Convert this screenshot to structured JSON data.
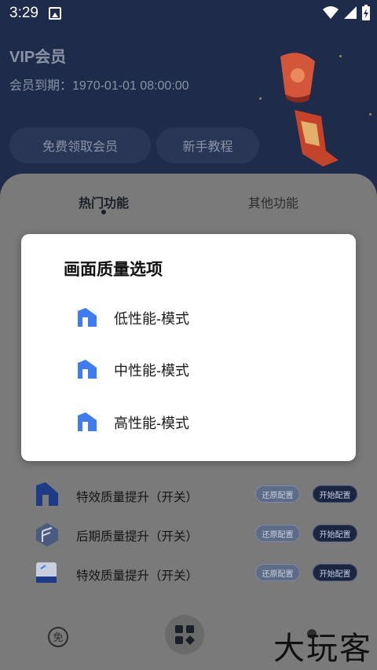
{
  "status_bar": {
    "time": "3:29"
  },
  "header": {
    "vip_title": "VIP会员",
    "vip_expire": "会员到期：1970-01-01 08:00:00",
    "free_vip_button": "免费领取会员",
    "beginner_guide_button": "新手教程"
  },
  "tabs": {
    "hot": "热门功能",
    "other": "其他功能"
  },
  "rows": [
    {
      "label": "特效质量提升（开关）",
      "restore": "还原配置",
      "start": "开始配置",
      "icon": "building-icon"
    },
    {
      "label": "后期质量提升（开关）",
      "restore": "还原配置",
      "start": "开始配置",
      "icon": "cube-icon"
    },
    {
      "label": "特效质量提升（开关）",
      "restore": "还原配置",
      "start": "开始配置",
      "icon": "card-icon"
    }
  ],
  "bottom_nav": {
    "free_icon_text": "免"
  },
  "dialog": {
    "title": "画面质量选项",
    "options": [
      {
        "label": "低性能-模式",
        "icon": "building-icon"
      },
      {
        "label": "中性能-模式",
        "icon": "building-icon"
      },
      {
        "label": "高性能-模式",
        "icon": "building-icon"
      }
    ]
  },
  "watermark": "大玩客",
  "colors": {
    "dark_bg": "#1e2b4a",
    "accent_blue": "#3f7cf0"
  }
}
